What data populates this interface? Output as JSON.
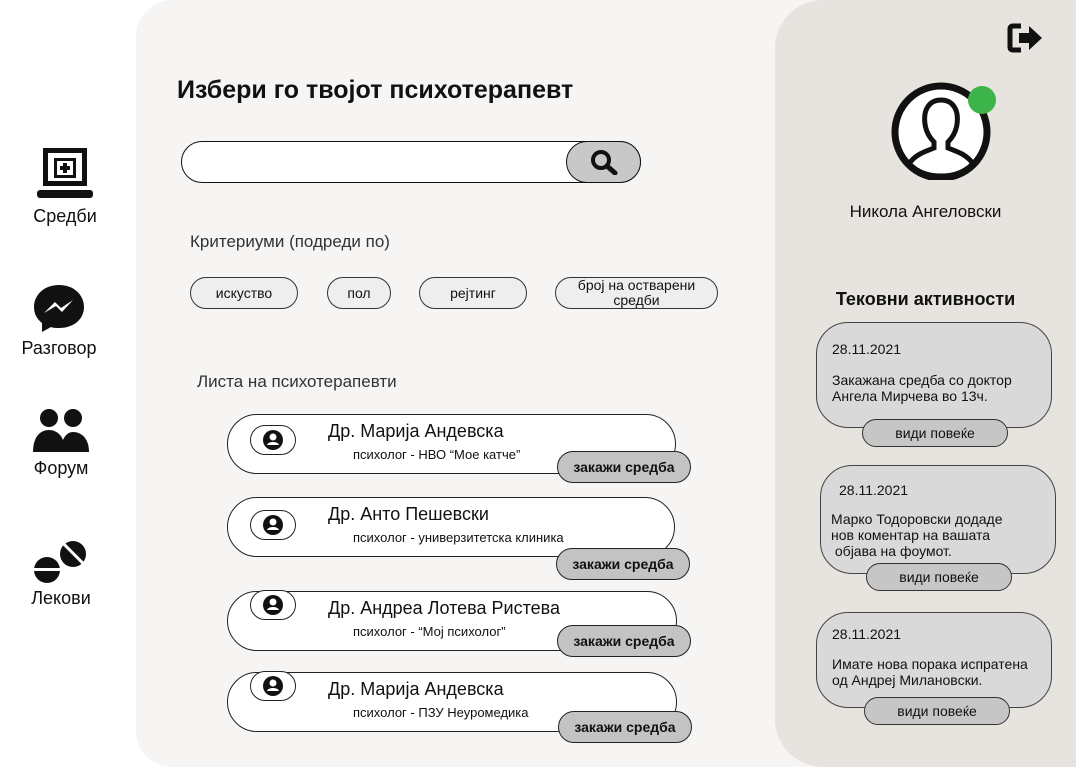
{
  "nav": {
    "sessions": {
      "label": "Средби",
      "icon": "laptop-medical-icon"
    },
    "chat": {
      "label": "Разговор",
      "icon": "messenger-icon"
    },
    "forum": {
      "label": "Форум",
      "icon": "users-icon"
    },
    "meds": {
      "label": "Лекови",
      "icon": "pills-icon"
    }
  },
  "main": {
    "title": "Избери го твојот психотерапевт",
    "search": {
      "value": "",
      "placeholder": "",
      "icon": "search-icon"
    },
    "criteria_label": "Критериуми (подреди по)",
    "criteria": [
      "искуство",
      "пол",
      "рејтинг",
      "број на остварени средби"
    ],
    "list_label": "Листа на психотерапевти",
    "book_label": "закажи средба",
    "therapists": [
      {
        "name": "Др. Марија Андевска",
        "subtitle": "психолог  -  НВО “Мое катче”"
      },
      {
        "name": "Др. Анто Пешевски",
        "subtitle": "психолог - универзитетска клиника"
      },
      {
        "name": "Др. Андреа Лотева Ристева",
        "subtitle": "психолог -  “Мој психолог”"
      },
      {
        "name": "Др. Марија Андевска",
        "subtitle": "психолог  -  ПЗУ Неуромедика"
      }
    ]
  },
  "profile": {
    "name": "Никола Ангеловски",
    "status": "online",
    "logout_icon": "sign-out-icon",
    "avatar_icon": "user-avatar-icon"
  },
  "activities": {
    "title": "Тековни активности",
    "more_label": "види повеќе",
    "items": [
      {
        "date": "28.11.2021",
        "text": "Закажана средба со доктор\nАнгела Мирчева во 13ч."
      },
      {
        "date": "28.11.2021",
        "text": "Марко Тодоровски додаде\nнов коментар на вашата\n објава на фоумот."
      },
      {
        "date": "28.11.2021",
        "text": "Имате нова порака испратена\nод Андреј Милановски."
      }
    ]
  },
  "colors": {
    "main_bg": "#f6f5f3",
    "right_bg": "#e7e4e0",
    "button_grey": "#c3c3c3",
    "online_green": "#3cb44a"
  }
}
